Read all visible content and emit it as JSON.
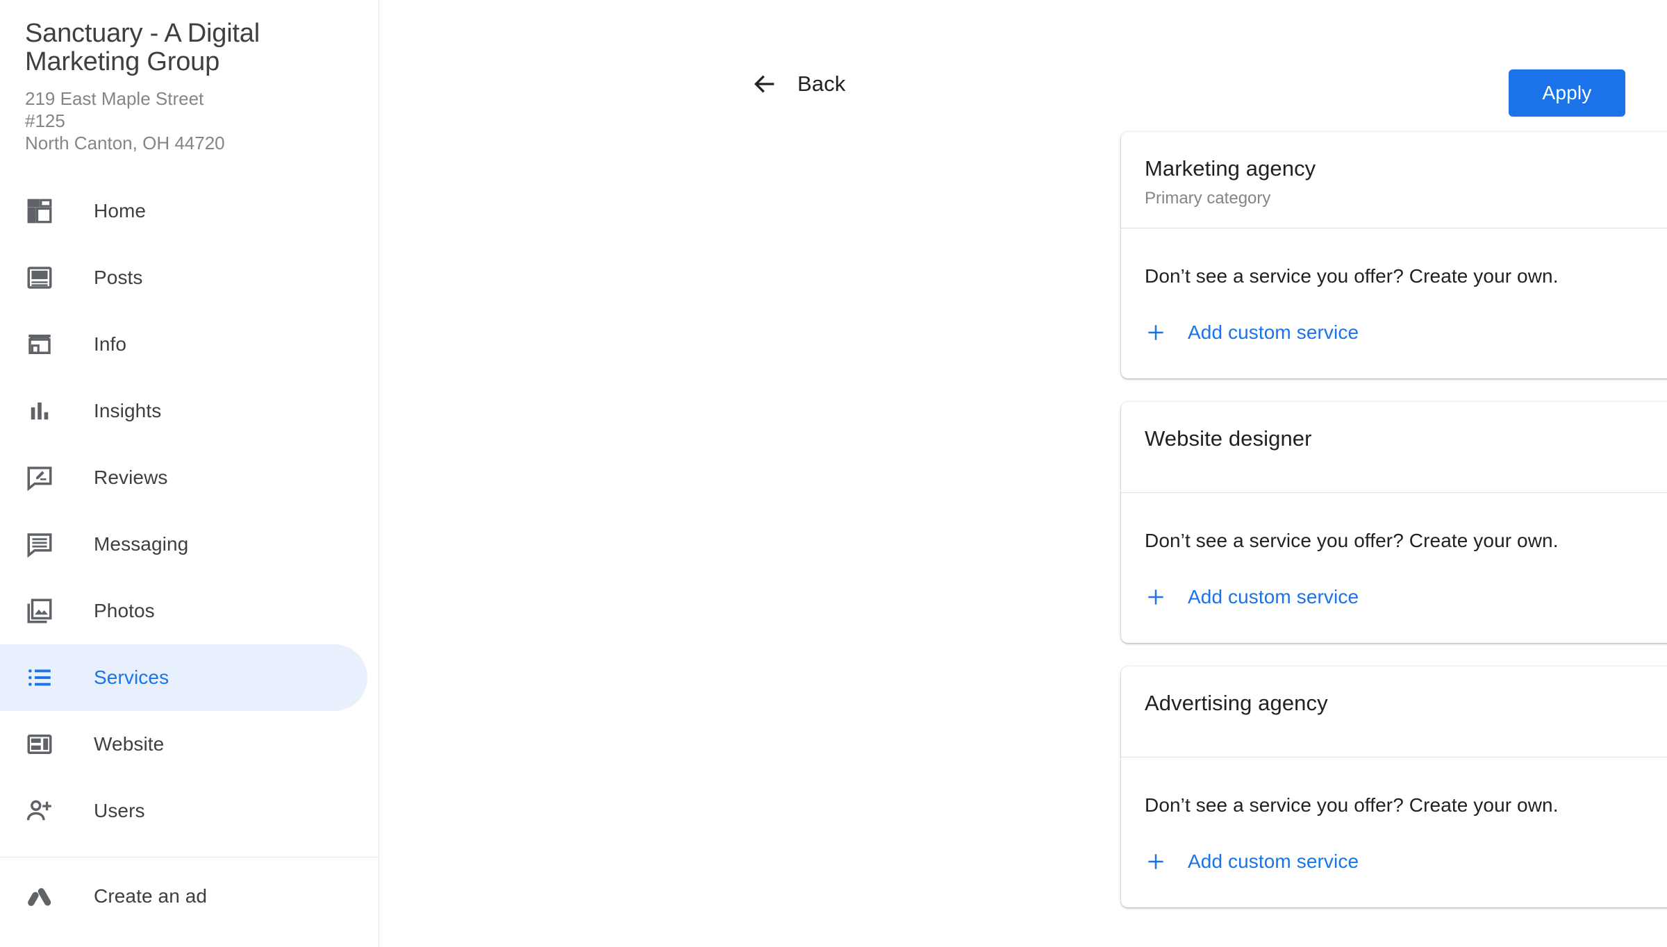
{
  "sidebar": {
    "business": {
      "name": "Sanctuary - A Digital Marketing Group",
      "address_line1": "219 East Maple Street",
      "address_line2": "#125",
      "address_line3": "North Canton, OH 44720"
    },
    "items": [
      {
        "label": "Home",
        "icon": "dashboard-icon",
        "active": false
      },
      {
        "label": "Posts",
        "icon": "posts-icon",
        "active": false
      },
      {
        "label": "Info",
        "icon": "storefront-icon",
        "active": false
      },
      {
        "label": "Insights",
        "icon": "bar-chart-icon",
        "active": false
      },
      {
        "label": "Reviews",
        "icon": "review-icon",
        "active": false
      },
      {
        "label": "Messaging",
        "icon": "message-icon",
        "active": false
      },
      {
        "label": "Photos",
        "icon": "photo-library-icon",
        "active": false
      },
      {
        "label": "Services",
        "icon": "list-icon",
        "active": true
      },
      {
        "label": "Website",
        "icon": "web-layout-icon",
        "active": false
      },
      {
        "label": "Users",
        "icon": "person-add-icon",
        "active": false
      }
    ],
    "bottom_items": [
      {
        "label": "Create an ad",
        "icon": "google-ads-icon",
        "active": false
      }
    ]
  },
  "header": {
    "back_label": "Back",
    "back_icon": "arrow-left-icon",
    "apply_label": "Apply"
  },
  "colors": {
    "accent_blue": "#1a73e8",
    "active_pill": "#e8f0fe",
    "text_primary": "#202124",
    "text_secondary": "#80868b",
    "icon_gray": "#5f6368",
    "divider": "#e0e0e0"
  },
  "common": {
    "prompt_text": "Don’t see a service you offer? Create your own.",
    "add_service_label": "Add custom service",
    "add_icon": "plus-icon",
    "edit_icon": "pencil-icon",
    "delete_icon": "trash-icon"
  },
  "cards": [
    {
      "title": "Marketing agency",
      "subtitle": "Primary category",
      "has_subtitle": true,
      "has_edit": true,
      "has_delete": false,
      "prompt_text": "Don’t see a service you offer? Create your own.",
      "add_service_label": "Add custom service"
    },
    {
      "title": "Website designer",
      "subtitle": "",
      "has_subtitle": false,
      "has_edit": true,
      "has_delete": true,
      "prompt_text": "Don’t see a service you offer? Create your own.",
      "add_service_label": "Add custom service"
    },
    {
      "title": "Advertising agency",
      "subtitle": "",
      "has_subtitle": false,
      "has_edit": true,
      "has_delete": true,
      "prompt_text": "Don’t see a service you offer? Create your own.",
      "add_service_label": "Add custom service"
    }
  ]
}
